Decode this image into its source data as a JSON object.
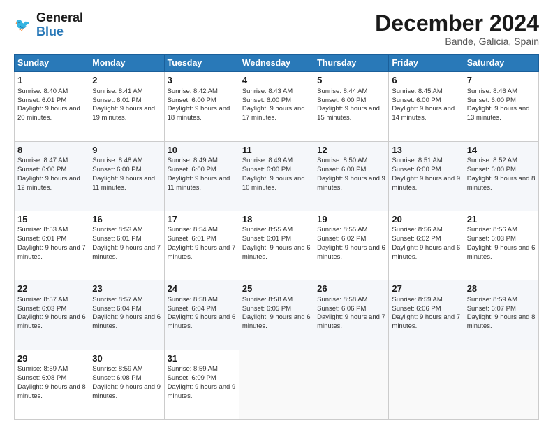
{
  "logo": {
    "line1": "General",
    "line2": "Blue"
  },
  "title": "December 2024",
  "subtitle": "Bande, Galicia, Spain",
  "days_of_week": [
    "Sunday",
    "Monday",
    "Tuesday",
    "Wednesday",
    "Thursday",
    "Friday",
    "Saturday"
  ],
  "weeks": [
    [
      {
        "day": 1,
        "sunrise": "8:40 AM",
        "sunset": "6:01 PM",
        "daylight": "9 hours and 20 minutes"
      },
      {
        "day": 2,
        "sunrise": "8:41 AM",
        "sunset": "6:01 PM",
        "daylight": "9 hours and 19 minutes"
      },
      {
        "day": 3,
        "sunrise": "8:42 AM",
        "sunset": "6:00 PM",
        "daylight": "9 hours and 18 minutes"
      },
      {
        "day": 4,
        "sunrise": "8:43 AM",
        "sunset": "6:00 PM",
        "daylight": "9 hours and 17 minutes"
      },
      {
        "day": 5,
        "sunrise": "8:44 AM",
        "sunset": "6:00 PM",
        "daylight": "9 hours and 15 minutes"
      },
      {
        "day": 6,
        "sunrise": "8:45 AM",
        "sunset": "6:00 PM",
        "daylight": "9 hours and 14 minutes"
      },
      {
        "day": 7,
        "sunrise": "8:46 AM",
        "sunset": "6:00 PM",
        "daylight": "9 hours and 13 minutes"
      }
    ],
    [
      {
        "day": 8,
        "sunrise": "8:47 AM",
        "sunset": "6:00 PM",
        "daylight": "9 hours and 12 minutes"
      },
      {
        "day": 9,
        "sunrise": "8:48 AM",
        "sunset": "6:00 PM",
        "daylight": "9 hours and 11 minutes"
      },
      {
        "day": 10,
        "sunrise": "8:49 AM",
        "sunset": "6:00 PM",
        "daylight": "9 hours and 11 minutes"
      },
      {
        "day": 11,
        "sunrise": "8:49 AM",
        "sunset": "6:00 PM",
        "daylight": "9 hours and 10 minutes"
      },
      {
        "day": 12,
        "sunrise": "8:50 AM",
        "sunset": "6:00 PM",
        "daylight": "9 hours and 9 minutes"
      },
      {
        "day": 13,
        "sunrise": "8:51 AM",
        "sunset": "6:00 PM",
        "daylight": "9 hours and 9 minutes"
      },
      {
        "day": 14,
        "sunrise": "8:52 AM",
        "sunset": "6:00 PM",
        "daylight": "9 hours and 8 minutes"
      }
    ],
    [
      {
        "day": 15,
        "sunrise": "8:53 AM",
        "sunset": "6:01 PM",
        "daylight": "9 hours and 7 minutes"
      },
      {
        "day": 16,
        "sunrise": "8:53 AM",
        "sunset": "6:01 PM",
        "daylight": "9 hours and 7 minutes"
      },
      {
        "day": 17,
        "sunrise": "8:54 AM",
        "sunset": "6:01 PM",
        "daylight": "9 hours and 7 minutes"
      },
      {
        "day": 18,
        "sunrise": "8:55 AM",
        "sunset": "6:01 PM",
        "daylight": "9 hours and 6 minutes"
      },
      {
        "day": 19,
        "sunrise": "8:55 AM",
        "sunset": "6:02 PM",
        "daylight": "9 hours and 6 minutes"
      },
      {
        "day": 20,
        "sunrise": "8:56 AM",
        "sunset": "6:02 PM",
        "daylight": "9 hours and 6 minutes"
      },
      {
        "day": 21,
        "sunrise": "8:56 AM",
        "sunset": "6:03 PM",
        "daylight": "9 hours and 6 minutes"
      }
    ],
    [
      {
        "day": 22,
        "sunrise": "8:57 AM",
        "sunset": "6:03 PM",
        "daylight": "9 hours and 6 minutes"
      },
      {
        "day": 23,
        "sunrise": "8:57 AM",
        "sunset": "6:04 PM",
        "daylight": "9 hours and 6 minutes"
      },
      {
        "day": 24,
        "sunrise": "8:58 AM",
        "sunset": "6:04 PM",
        "daylight": "9 hours and 6 minutes"
      },
      {
        "day": 25,
        "sunrise": "8:58 AM",
        "sunset": "6:05 PM",
        "daylight": "9 hours and 6 minutes"
      },
      {
        "day": 26,
        "sunrise": "8:58 AM",
        "sunset": "6:06 PM",
        "daylight": "9 hours and 7 minutes"
      },
      {
        "day": 27,
        "sunrise": "8:59 AM",
        "sunset": "6:06 PM",
        "daylight": "9 hours and 7 minutes"
      },
      {
        "day": 28,
        "sunrise": "8:59 AM",
        "sunset": "6:07 PM",
        "daylight": "9 hours and 8 minutes"
      }
    ],
    [
      {
        "day": 29,
        "sunrise": "8:59 AM",
        "sunset": "6:08 PM",
        "daylight": "9 hours and 8 minutes"
      },
      {
        "day": 30,
        "sunrise": "8:59 AM",
        "sunset": "6:08 PM",
        "daylight": "9 hours and 9 minutes"
      },
      {
        "day": 31,
        "sunrise": "8:59 AM",
        "sunset": "6:09 PM",
        "daylight": "9 hours and 9 minutes"
      },
      null,
      null,
      null,
      null
    ]
  ]
}
